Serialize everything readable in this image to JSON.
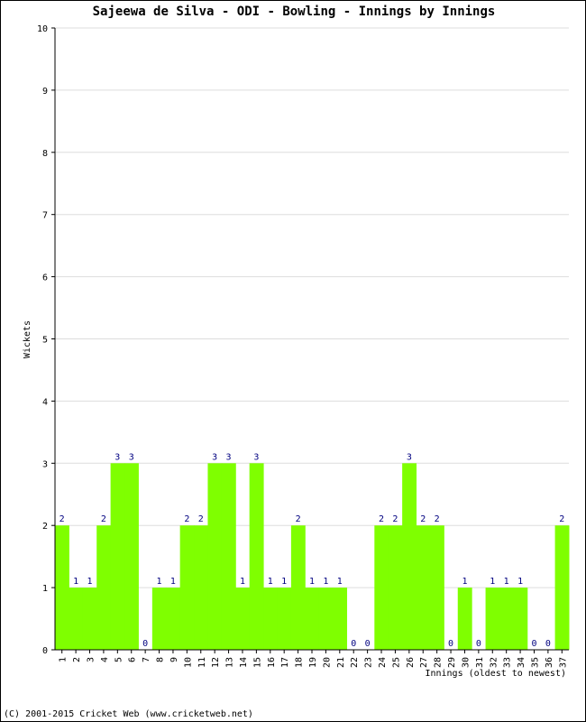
{
  "chart_data": {
    "type": "bar",
    "title": "Sajeewa de Silva - ODI - Bowling - Innings by Innings",
    "xlabel": "Innings (oldest to newest)",
    "ylabel": "Wickets",
    "ylim": [
      0,
      10
    ],
    "yticks": [
      0,
      1,
      2,
      3,
      4,
      5,
      6,
      7,
      8,
      9,
      10
    ],
    "grid": true,
    "categories": [
      "1",
      "2",
      "3",
      "4",
      "5",
      "6",
      "7",
      "8",
      "9",
      "10",
      "11",
      "12",
      "13",
      "14",
      "15",
      "16",
      "17",
      "18",
      "19",
      "20",
      "21",
      "22",
      "23",
      "24",
      "25",
      "26",
      "27",
      "28",
      "29",
      "30",
      "31",
      "32",
      "33",
      "34",
      "35",
      "36",
      "37"
    ],
    "values": [
      2,
      1,
      1,
      2,
      3,
      3,
      0,
      1,
      1,
      2,
      2,
      3,
      3,
      1,
      3,
      1,
      1,
      2,
      1,
      1,
      1,
      0,
      0,
      2,
      2,
      3,
      2,
      2,
      0,
      1,
      0,
      1,
      1,
      1,
      0,
      0,
      2
    ],
    "bar_color": "#7fff00",
    "label_color": "#000080",
    "grid_color": "#dddddd"
  },
  "footer": {
    "copyright": "(C) 2001-2015 Cricket Web (www.cricketweb.net)"
  }
}
